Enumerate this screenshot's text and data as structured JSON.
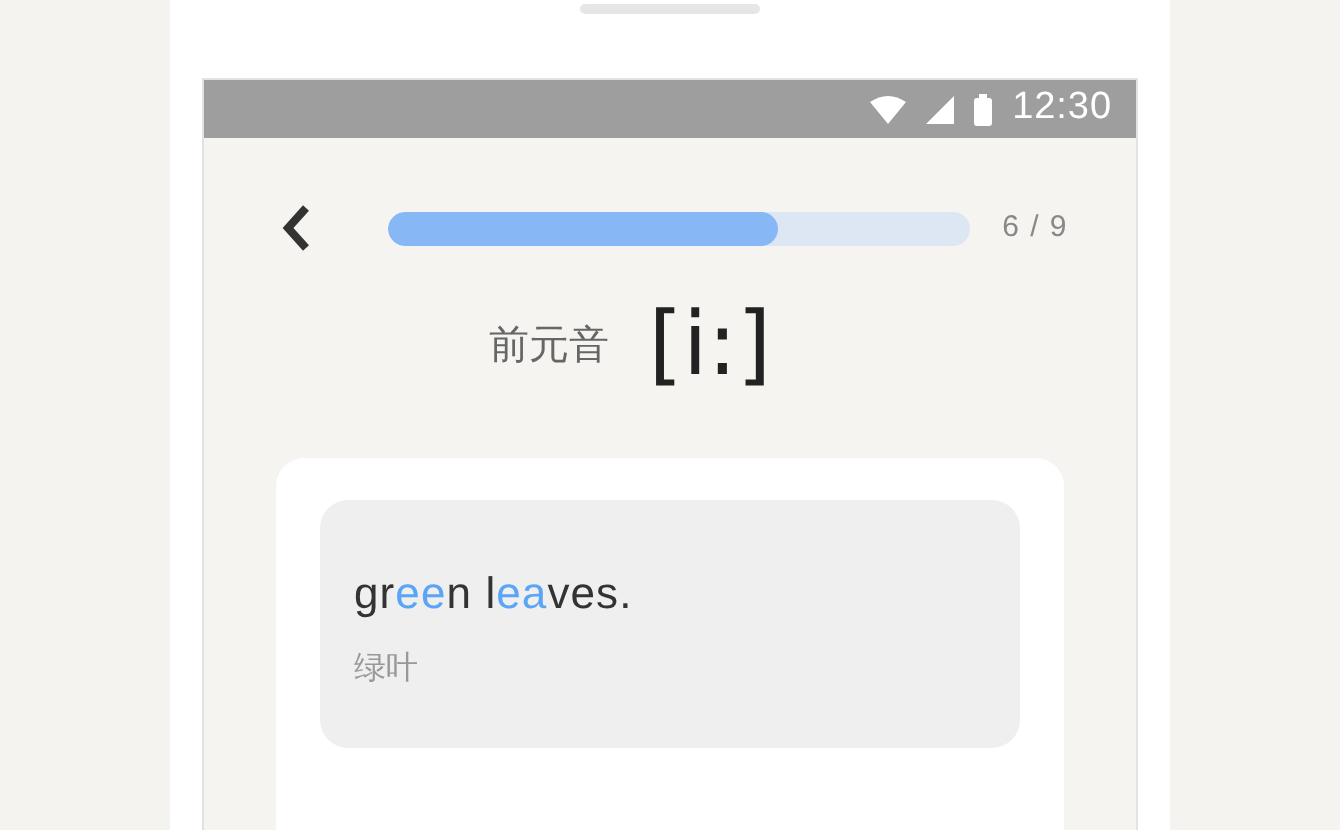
{
  "status_bar": {
    "time": "12:30"
  },
  "progress": {
    "level": 0.67,
    "count": "6 / 9"
  },
  "phoneme": {
    "category": "前元音",
    "symbol": "[i:]"
  },
  "example": {
    "segments": [
      {
        "text": "gr",
        "highlighted": false
      },
      {
        "text": "ee",
        "highlighted": true
      },
      {
        "text": "n l",
        "highlighted": false
      },
      {
        "text": "ea",
        "highlighted": true
      },
      {
        "text": "ves.",
        "highlighted": false
      }
    ],
    "translation": "绿叶"
  }
}
